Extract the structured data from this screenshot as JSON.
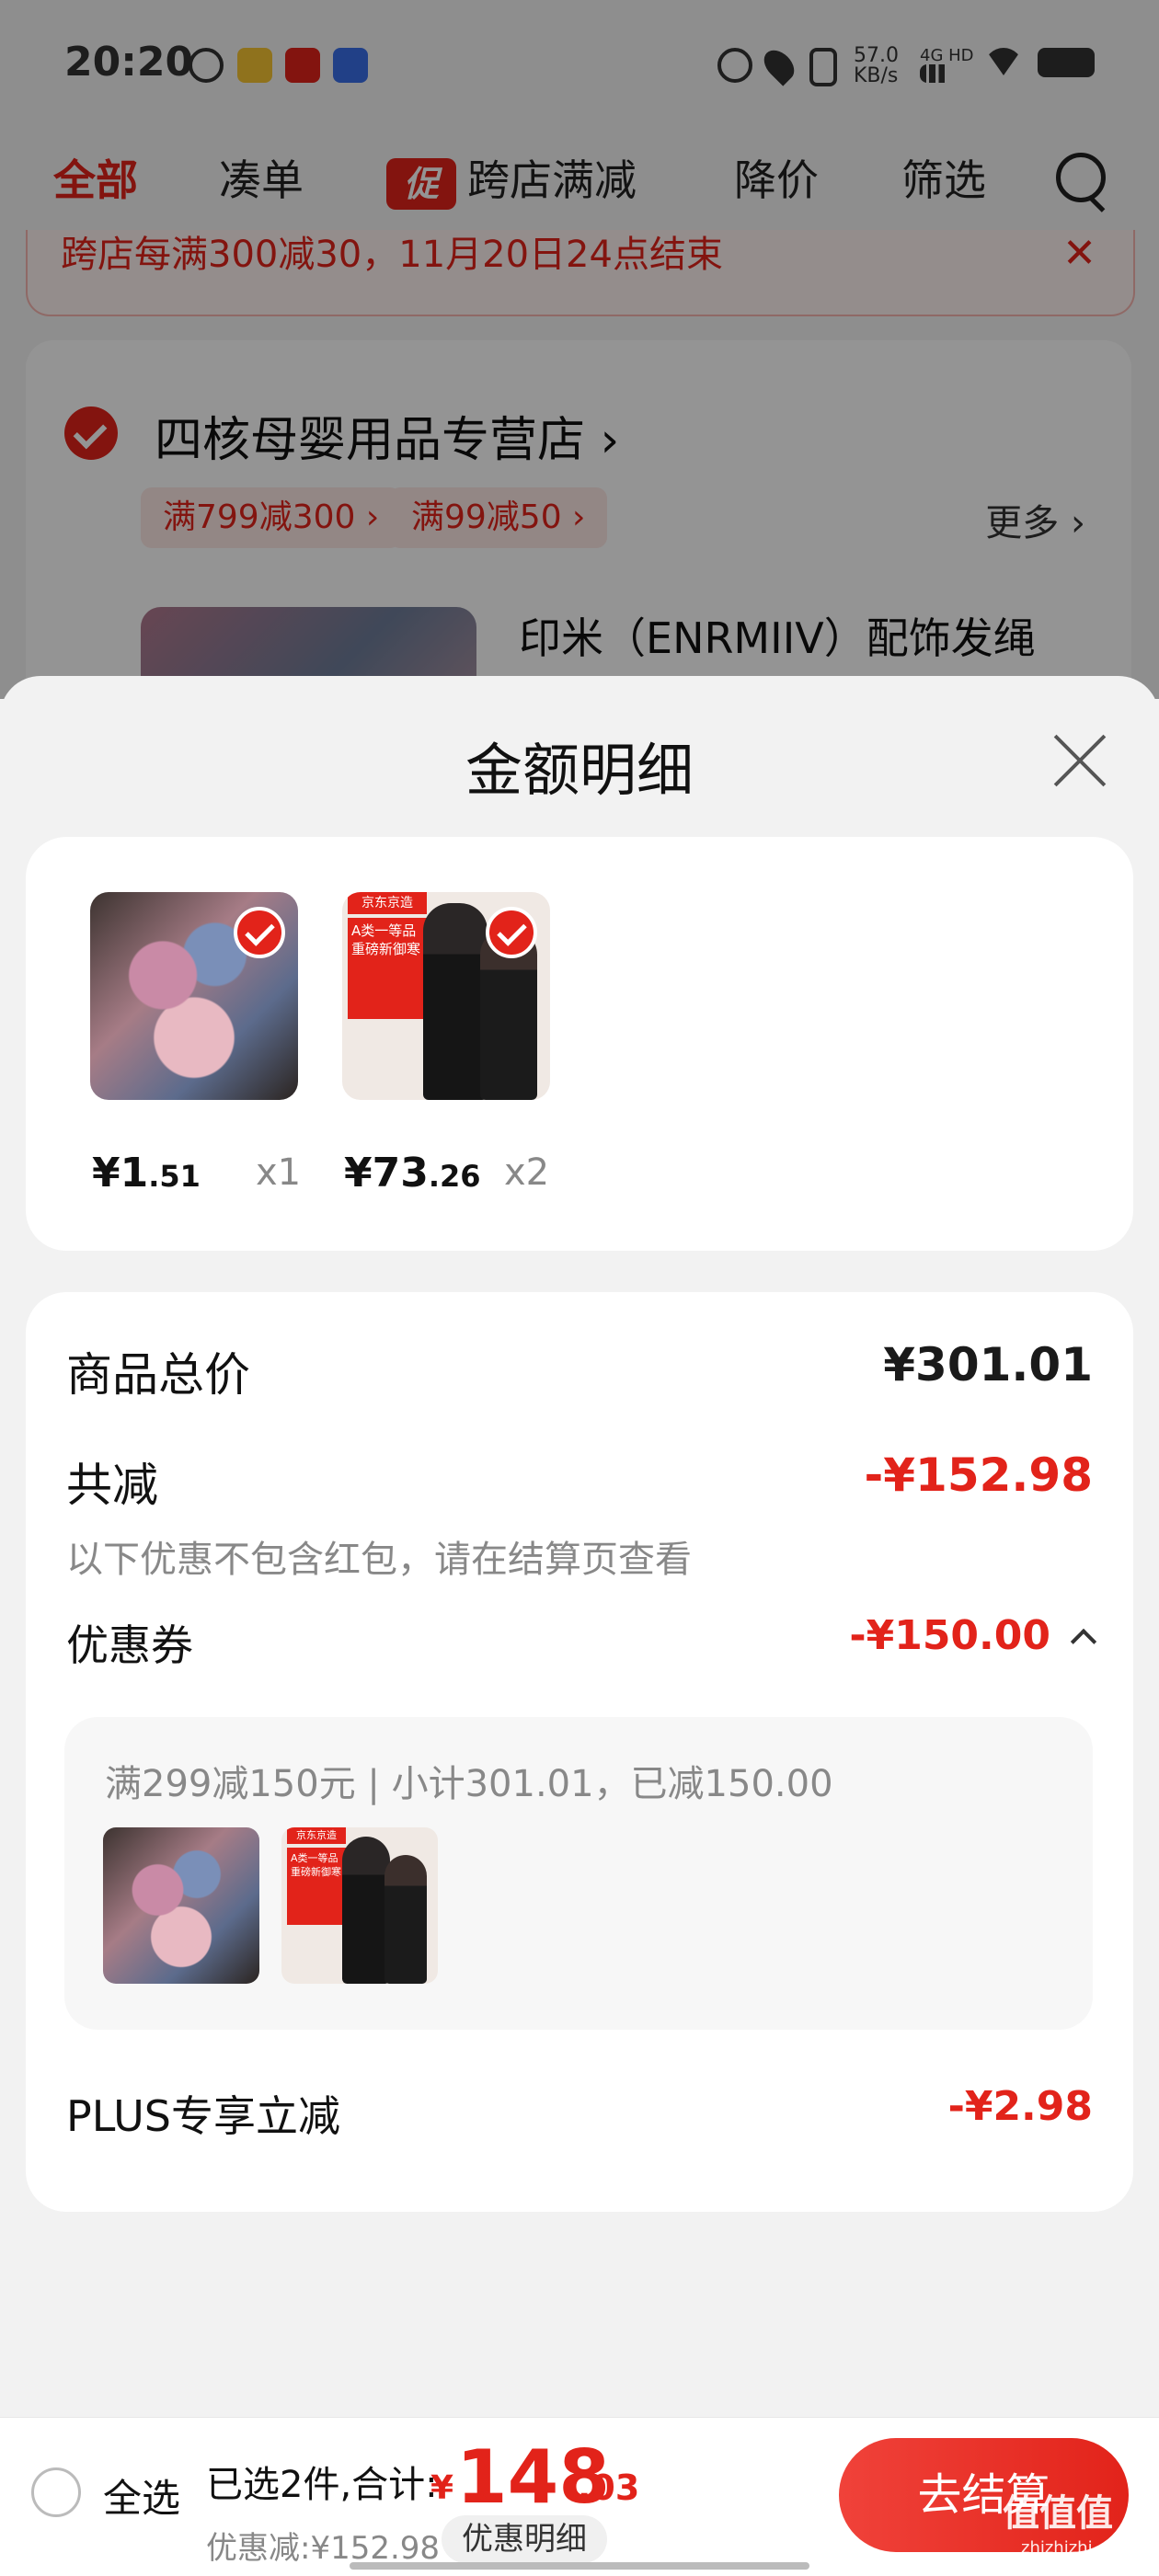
{
  "status_bar": {
    "time": "20:20",
    "net_speed": "57.0\nKB/s",
    "net_type": "4G HD",
    "icons": [
      "alarm-icon",
      "weibo-icon",
      "app-icon",
      "baidu-icon",
      "alarm-icon",
      "location-icon",
      "vibrate-icon",
      "signal-icon",
      "wifi-icon",
      "battery-icon"
    ]
  },
  "tabs": [
    "全部",
    "凑单",
    "跨店满减",
    "降价",
    "筛选"
  ],
  "promo_badge": "促",
  "notice": "跨店每满300减30，11月20日24点结束",
  "store": {
    "name": "四核母婴用品专营店",
    "chips": [
      "满799减300 ›",
      "满99减50 ›"
    ],
    "more": "更多 ›",
    "product_title": "印米（ENRMIIV）配饰发绳"
  },
  "sheet": {
    "title": "金额明细",
    "products": [
      {
        "price_int": "¥1",
        "price_dec": ".51",
        "qty": "x1"
      },
      {
        "price_int": "¥73",
        "price_dec": ".26",
        "qty": "x2"
      }
    ],
    "thermal_banner": "京东京造",
    "thermal_text": "A类一等品 重磅新御寒",
    "total_label": "商品总价",
    "total_value": "¥301.01",
    "reduce_label": "共减",
    "reduce_value": "-¥152.98",
    "reduce_note": "以下优惠不包含红包，请在结算页查看",
    "coupon_label": "优惠券",
    "coupon_value": "-¥150.00",
    "coupon_detail": "满299减150元 | 小计301.01，已减150.00",
    "plus_label": "PLUS专享立减",
    "plus_value": "-¥2.98"
  },
  "bottom": {
    "select_all": "全选",
    "summary": "已选2件,合计:",
    "total_yen": "¥",
    "total_int": "148",
    "total_dec": ".03",
    "discount": "优惠减:¥152.98",
    "detail_btn": "优惠明细",
    "checkout": "去结算"
  },
  "watermark": "值值值",
  "watermark_url": "zhizhizhi.com",
  "colors": {
    "accent": "#e2231a",
    "sheet_bg": "#f2f2f2"
  }
}
